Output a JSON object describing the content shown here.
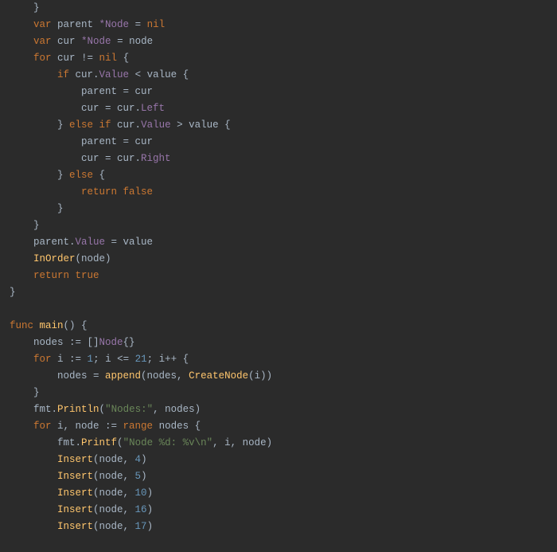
{
  "code": {
    "tokens": [
      {
        "indent": 1,
        "parts": [
          {
            "t": "}",
            "c": "op"
          }
        ]
      },
      {
        "indent": 1,
        "parts": [
          {
            "t": "var ",
            "c": "kw"
          },
          {
            "t": "parent ",
            "c": "id"
          },
          {
            "t": "*Node",
            "c": "prop"
          },
          {
            "t": " = ",
            "c": "op"
          },
          {
            "t": "nil",
            "c": "bool"
          }
        ]
      },
      {
        "indent": 1,
        "parts": [
          {
            "t": "var ",
            "c": "kw"
          },
          {
            "t": "cur ",
            "c": "id"
          },
          {
            "t": "*Node",
            "c": "prop"
          },
          {
            "t": " = ",
            "c": "op"
          },
          {
            "t": "node",
            "c": "id"
          }
        ]
      },
      {
        "indent": 1,
        "parts": [
          {
            "t": "for ",
            "c": "kw"
          },
          {
            "t": "cur != ",
            "c": "id"
          },
          {
            "t": "nil",
            "c": "bool"
          },
          {
            "t": " {",
            "c": "op"
          }
        ]
      },
      {
        "indent": 2,
        "parts": [
          {
            "t": "if ",
            "c": "kw"
          },
          {
            "t": "cur.",
            "c": "id"
          },
          {
            "t": "Value",
            "c": "prop"
          },
          {
            "t": " < value {",
            "c": "id"
          }
        ]
      },
      {
        "indent": 3,
        "parts": [
          {
            "t": "parent = cur",
            "c": "id"
          }
        ]
      },
      {
        "indent": 3,
        "parts": [
          {
            "t": "cur = cur.",
            "c": "id"
          },
          {
            "t": "Left",
            "c": "prop"
          }
        ]
      },
      {
        "indent": 2,
        "parts": [
          {
            "t": "} ",
            "c": "op"
          },
          {
            "t": "else if ",
            "c": "kw"
          },
          {
            "t": "cur.",
            "c": "id"
          },
          {
            "t": "Value",
            "c": "prop"
          },
          {
            "t": " > value {",
            "c": "id"
          }
        ]
      },
      {
        "indent": 3,
        "parts": [
          {
            "t": "parent = cur",
            "c": "id"
          }
        ]
      },
      {
        "indent": 3,
        "parts": [
          {
            "t": "cur = cur.",
            "c": "id"
          },
          {
            "t": "Right",
            "c": "prop"
          }
        ]
      },
      {
        "indent": 2,
        "parts": [
          {
            "t": "} ",
            "c": "op"
          },
          {
            "t": "else",
            "c": "kw"
          },
          {
            "t": " {",
            "c": "op"
          }
        ]
      },
      {
        "indent": 3,
        "parts": [
          {
            "t": "return ",
            "c": "kw"
          },
          {
            "t": "false",
            "c": "bool"
          }
        ]
      },
      {
        "indent": 2,
        "parts": [
          {
            "t": "}",
            "c": "op"
          }
        ]
      },
      {
        "indent": 1,
        "parts": [
          {
            "t": "}",
            "c": "op"
          }
        ]
      },
      {
        "indent": 1,
        "parts": [
          {
            "t": "parent.",
            "c": "id"
          },
          {
            "t": "Value",
            "c": "prop"
          },
          {
            "t": " = value",
            "c": "id"
          }
        ]
      },
      {
        "indent": 1,
        "parts": [
          {
            "t": "InOrder",
            "c": "fn"
          },
          {
            "t": "(node)",
            "c": "id"
          }
        ]
      },
      {
        "indent": 1,
        "parts": [
          {
            "t": "return ",
            "c": "kw"
          },
          {
            "t": "true",
            "c": "bool"
          }
        ]
      },
      {
        "indent": 0,
        "parts": [
          {
            "t": "}",
            "c": "op"
          }
        ]
      },
      {
        "indent": 0,
        "parts": []
      },
      {
        "indent": 0,
        "parts": [
          {
            "t": "func ",
            "c": "kw"
          },
          {
            "t": "main",
            "c": "fn"
          },
          {
            "t": "() {",
            "c": "op"
          }
        ]
      },
      {
        "indent": 1,
        "parts": [
          {
            "t": "nodes := []",
            "c": "id"
          },
          {
            "t": "Node",
            "c": "prop"
          },
          {
            "t": "{}",
            "c": "op"
          }
        ]
      },
      {
        "indent": 1,
        "parts": [
          {
            "t": "for ",
            "c": "kw"
          },
          {
            "t": "i := ",
            "c": "id"
          },
          {
            "t": "1",
            "c": "num"
          },
          {
            "t": "; i <= ",
            "c": "id"
          },
          {
            "t": "21",
            "c": "num"
          },
          {
            "t": "; i++ {",
            "c": "id"
          }
        ]
      },
      {
        "indent": 2,
        "parts": [
          {
            "t": "nodes = ",
            "c": "id"
          },
          {
            "t": "append",
            "c": "fn"
          },
          {
            "t": "(nodes, ",
            "c": "id"
          },
          {
            "t": "CreateNode",
            "c": "fn"
          },
          {
            "t": "(i))",
            "c": "id"
          }
        ]
      },
      {
        "indent": 1,
        "parts": [
          {
            "t": "}",
            "c": "op"
          }
        ]
      },
      {
        "indent": 1,
        "parts": [
          {
            "t": "fmt.",
            "c": "id"
          },
          {
            "t": "Println",
            "c": "fn"
          },
          {
            "t": "(",
            "c": "op"
          },
          {
            "t": "\"Nodes:\"",
            "c": "str"
          },
          {
            "t": ", nodes)",
            "c": "id"
          }
        ]
      },
      {
        "indent": 1,
        "parts": [
          {
            "t": "for ",
            "c": "kw"
          },
          {
            "t": "i, node := ",
            "c": "id"
          },
          {
            "t": "range ",
            "c": "kw"
          },
          {
            "t": "nodes {",
            "c": "id"
          }
        ]
      },
      {
        "indent": 2,
        "parts": [
          {
            "t": "fmt.",
            "c": "id"
          },
          {
            "t": "Printf",
            "c": "fn"
          },
          {
            "t": "(",
            "c": "op"
          },
          {
            "t": "\"Node %d: %v\\n\"",
            "c": "str"
          },
          {
            "t": ", i, node)",
            "c": "id"
          }
        ]
      },
      {
        "indent": 2,
        "parts": [
          {
            "t": "Insert",
            "c": "fn"
          },
          {
            "t": "(node, ",
            "c": "id"
          },
          {
            "t": "4",
            "c": "num"
          },
          {
            "t": ")",
            "c": "op"
          }
        ]
      },
      {
        "indent": 2,
        "parts": [
          {
            "t": "Insert",
            "c": "fn"
          },
          {
            "t": "(node, ",
            "c": "id"
          },
          {
            "t": "5",
            "c": "num"
          },
          {
            "t": ")",
            "c": "op"
          }
        ]
      },
      {
        "indent": 2,
        "parts": [
          {
            "t": "Insert",
            "c": "fn"
          },
          {
            "t": "(node, ",
            "c": "id"
          },
          {
            "t": "10",
            "c": "num"
          },
          {
            "t": ")",
            "c": "op"
          }
        ]
      },
      {
        "indent": 2,
        "parts": [
          {
            "t": "Insert",
            "c": "fn"
          },
          {
            "t": "(node, ",
            "c": "id"
          },
          {
            "t": "16",
            "c": "num"
          },
          {
            "t": ")",
            "c": "op"
          }
        ]
      },
      {
        "indent": 2,
        "parts": [
          {
            "t": "Insert",
            "c": "fn"
          },
          {
            "t": "(node, ",
            "c": "id"
          },
          {
            "t": "17",
            "c": "num"
          },
          {
            "t": ")",
            "c": "op"
          }
        ]
      }
    ],
    "indent_unit": "    "
  }
}
